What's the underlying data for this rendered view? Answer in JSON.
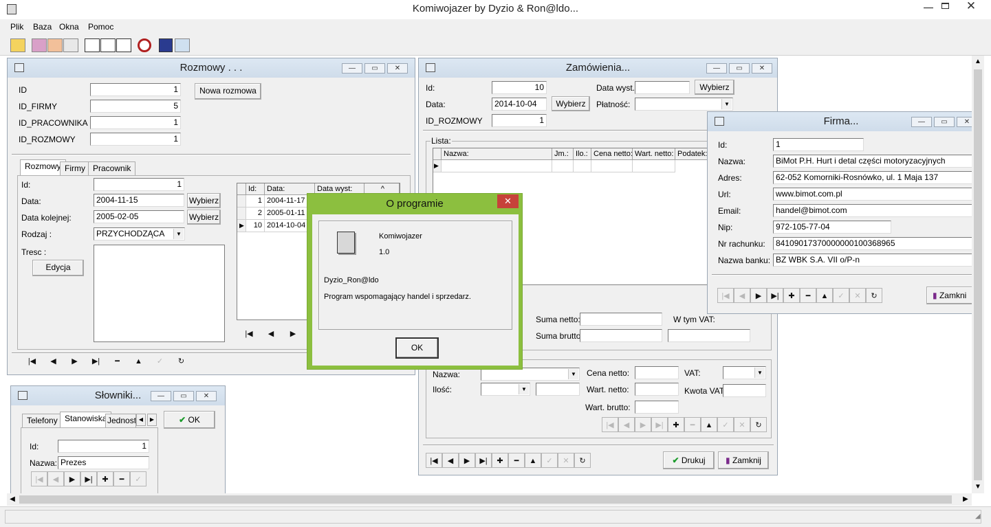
{
  "app": {
    "title": "Komiwojazer by Dyzio & Ron@ldo...",
    "menu": [
      "Plik",
      "Baza",
      "Okna",
      "Pomoc"
    ]
  },
  "rozmowy": {
    "title": "Rozmowy . . .",
    "fields": [
      {
        "label": "ID",
        "value": "1"
      },
      {
        "label": "ID_FIRMY",
        "value": "5"
      },
      {
        "label": "ID_PRACOWNIKA",
        "value": "1"
      },
      {
        "label": "ID_ROZMOWY",
        "value": "1"
      }
    ],
    "new_button": "Nowa rozmowa",
    "tabs": [
      "Rozmowy",
      "Firmy",
      "Pracownik"
    ],
    "id_label": "Id:",
    "id_value": "1",
    "data_label": "Data:",
    "data_value": "2004-11-15",
    "next_label": "Data kolejnej:",
    "next_value": "2005-02-05",
    "kind_label": "Rodzaj :",
    "kind_value": "PRZYCHODZĄCA",
    "text_label": "Tresc :",
    "edit_button": "Edycja",
    "choose_button": "Wybierz",
    "grid": {
      "columns": [
        "Id:",
        "Data:",
        "Data wyst:"
      ],
      "rows": [
        [
          "1",
          "2004-11-17",
          ""
        ],
        [
          "2",
          "2005-01-11",
          ""
        ],
        [
          "10",
          "2014-10-04",
          ""
        ]
      ]
    }
  },
  "zamowienia": {
    "title": "Zamówienia...",
    "id_label": "Id:",
    "id_value": "10",
    "data_label": "Data:",
    "data_value": "2014-10-04",
    "rozmowy_label": "ID_ROZMOWY",
    "rozmowy_value": "1",
    "data_wyst_label": "Data wyst.:",
    "platnosc_label": "Płatność:",
    "choose_button": "Wybierz",
    "lista_label": "Lista:",
    "columns": [
      "Nazwa:",
      "Jm.:",
      "Ilo.:",
      "Cena netto:",
      "Wart. netto:",
      "Podatek:"
    ],
    "suma_netto": "Suma netto:",
    "suma_brutto": "Suma brutto:",
    "w_tym_vat": "W tym VAT:",
    "nazwa_label": "Nazwa:",
    "ilosc_label": "Ilość:",
    "cena_netto": "Cena netto:",
    "wart_netto": "Wart. netto:",
    "wart_brutto": "Wart. brutto:",
    "vat_label": "VAT:",
    "kwota_vat": "Kwota VAT:",
    "print_button": "Drukuj",
    "close_button": "Zamknij"
  },
  "firma": {
    "title": "Firma...",
    "fields": [
      {
        "label": "Id:",
        "value": "1"
      },
      {
        "label": "Nazwa:",
        "value": "BiMot P.H. Hurt i detal części motoryzacyjnych"
      },
      {
        "label": "Adres:",
        "value": "62-052 Komorniki-Rosnówko, ul. 1 Maja 137"
      },
      {
        "label": "Url:",
        "value": "www.bimot.com.pl"
      },
      {
        "label": "Email:",
        "value": "handel@bimot.com"
      },
      {
        "label": "Nip:",
        "value": "972-105-77-04"
      },
      {
        "label": "Nr rachunku:",
        "value": "84109017370000000100368965"
      },
      {
        "label": "Nazwa banku:",
        "value": "BZ WBK S.A. VII o/P-n"
      }
    ],
    "close_button": "Zamkni"
  },
  "slowniki": {
    "title": "Słowniki...",
    "tabs": [
      "Telefony",
      "Stanowiska",
      "Jednostl"
    ],
    "ok_button": "OK",
    "id_label": "Id:",
    "id_value": "1",
    "nazwa_label": "Nazwa:",
    "nazwa_value": "Prezes"
  },
  "about": {
    "title": "O programie",
    "product": "Komiwojazer",
    "version": "1.0",
    "authors": "Dyzio_Ron@ldo",
    "description": "Program wspomagający handel i sprzedarz.",
    "ok_button": "OK"
  },
  "colors": {
    "about_border": "#8cbf3f",
    "about_close": "#c7423a",
    "mdi_title": "#dde8f3"
  }
}
